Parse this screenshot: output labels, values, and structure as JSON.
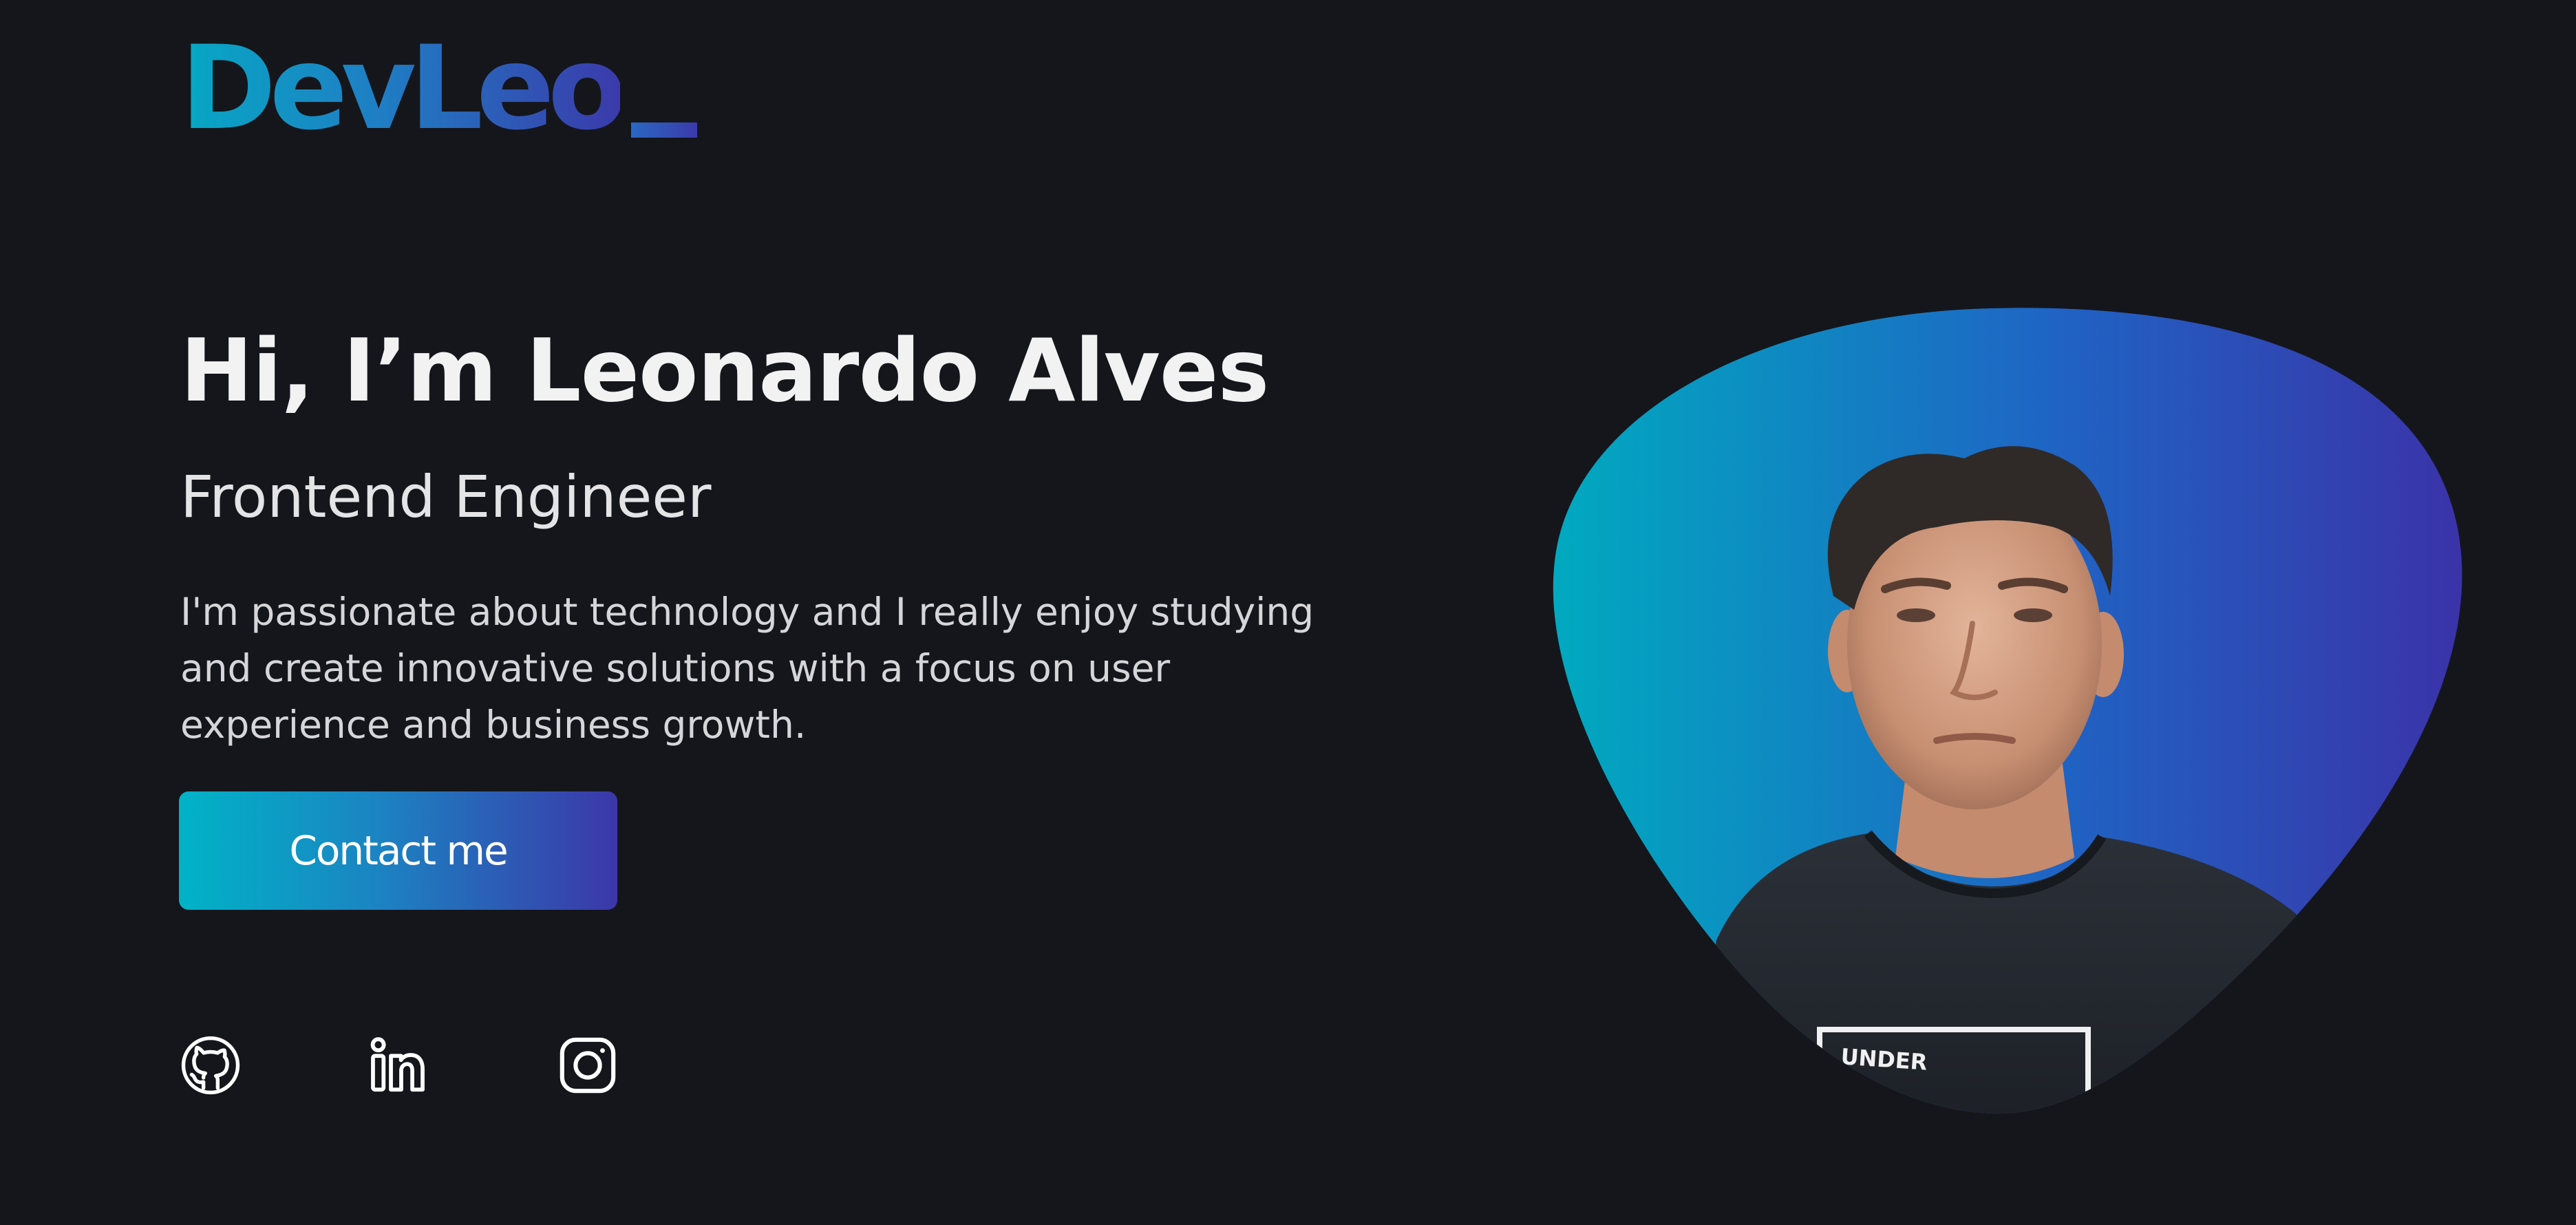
{
  "header": {
    "logo_text": "DevLeo"
  },
  "hero": {
    "title": "Hi, I’m Leonardo Alves",
    "subtitle": "Frontend Engineer",
    "description": "I'm passionate about technology and I really enjoy studying and create innovative solutions with a focus on user experience and business growth.",
    "cta_label": "Contact me"
  },
  "social": [
    {
      "icon": "github-icon"
    },
    {
      "icon": "linkedin-icon"
    },
    {
      "icon": "instagram-icon"
    }
  ],
  "photo": {
    "shirt_text": "UNDER"
  },
  "colors": {
    "background": "#15161b",
    "gradient_start": "#00b3c7",
    "gradient_end": "#3c37a9",
    "text": "#f2f2f3"
  }
}
